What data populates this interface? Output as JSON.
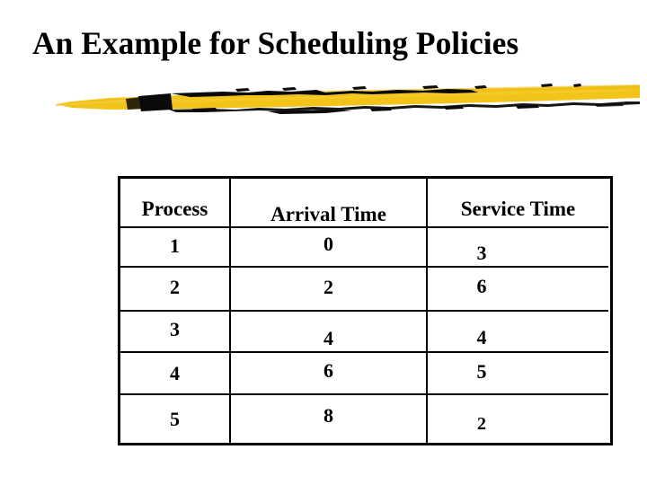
{
  "slide": {
    "title": "An Example for Scheduling Policies",
    "background_color": "#FFFFFF",
    "decoration": {
      "name": "brush-stroke-divider",
      "stroke_color": "#F2C318",
      "ink_color": "#0A0A0A"
    }
  },
  "table": {
    "name": "scheduling-example-table",
    "border_color": "#000000",
    "headers": [
      "Process",
      "Arrival Time",
      "Service Time"
    ],
    "rows": [
      {
        "process": "1",
        "arrival_time": "0",
        "service_time": "3"
      },
      {
        "process": "2",
        "arrival_time": "2",
        "service_time": "6"
      },
      {
        "process": "3",
        "arrival_time": "4",
        "service_time": "4"
      },
      {
        "process": "4",
        "arrival_time": "6",
        "service_time": "5"
      },
      {
        "process": "5",
        "arrival_time": "8",
        "service_time": "2"
      }
    ]
  }
}
